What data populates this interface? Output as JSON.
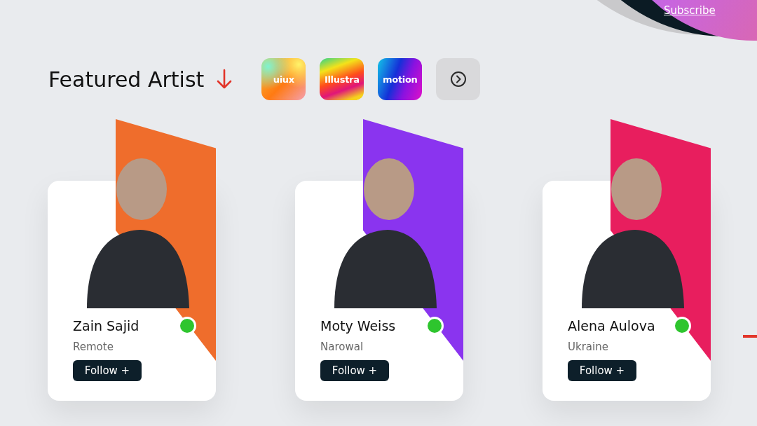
{
  "header_link": "Subscribe",
  "section": {
    "title": "Featured Artist"
  },
  "categories": [
    {
      "label": "uiux"
    },
    {
      "label": "Illustra"
    },
    {
      "label": "motion"
    }
  ],
  "artists": [
    {
      "name": "Zain Sajid",
      "location": "Remote",
      "online": true,
      "color": "#ef6d2c",
      "button": "Follow +"
    },
    {
      "name": "Moty Weiss",
      "location": "Narowal",
      "online": true,
      "color": "#8a34ef",
      "button": "Follow +"
    },
    {
      "name": "Alena Aulova",
      "location": "Ukraine",
      "online": true,
      "color": "#e81e5e",
      "button": "Follow +"
    }
  ]
}
